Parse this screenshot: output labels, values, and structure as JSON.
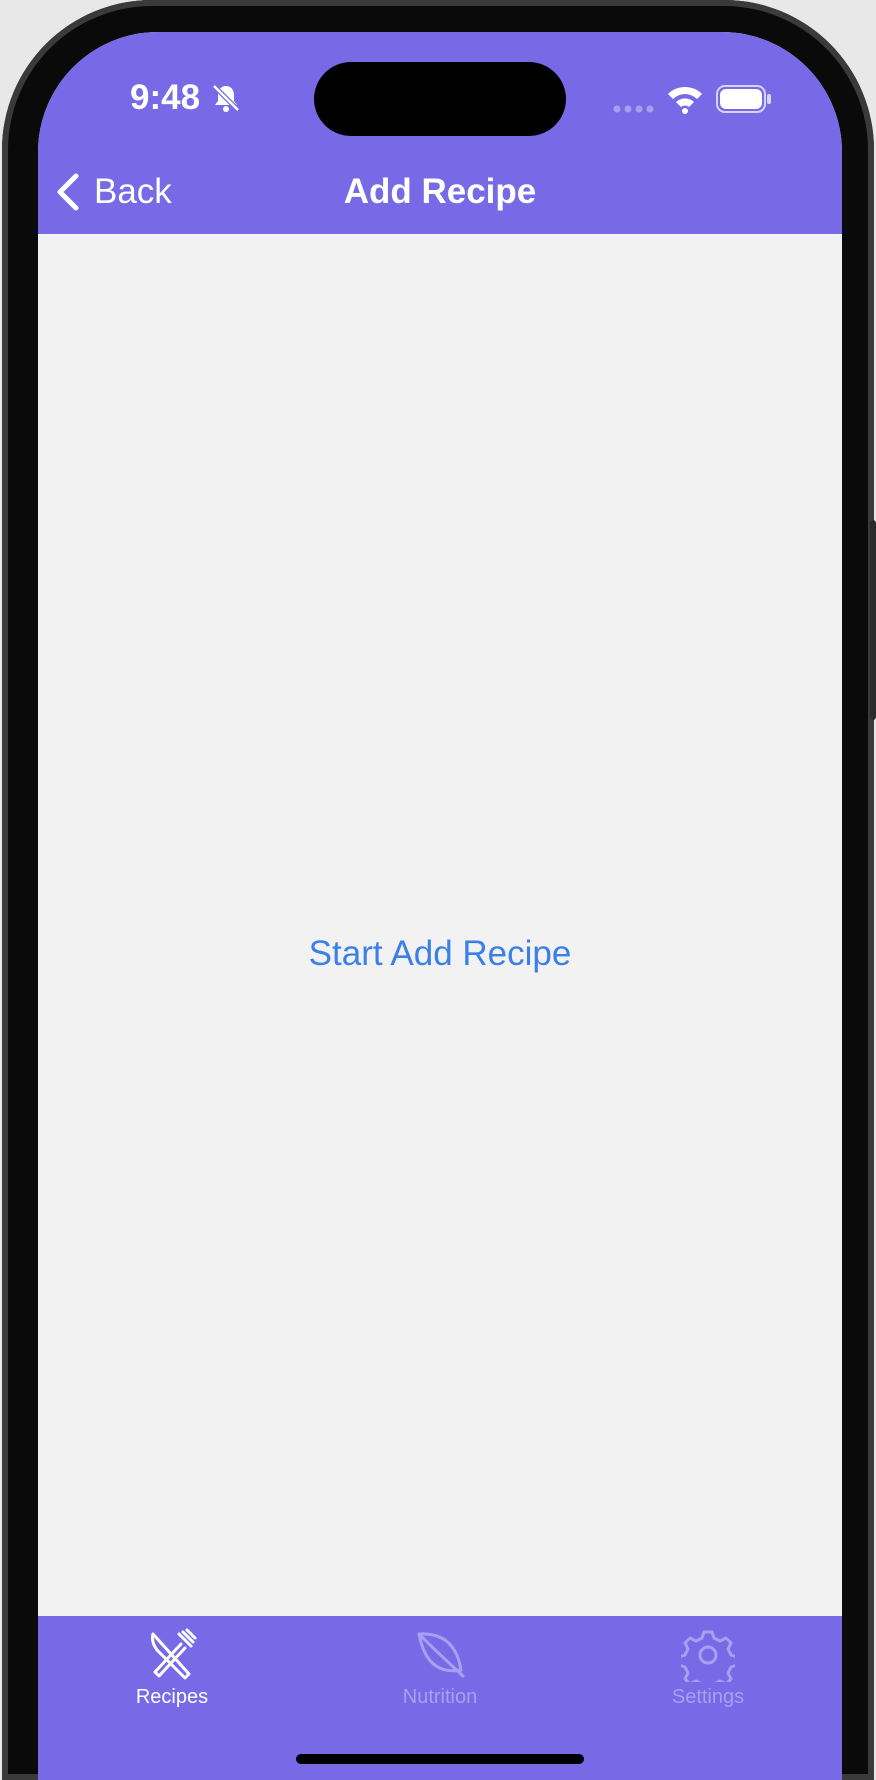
{
  "status_bar": {
    "time": "9:48"
  },
  "nav": {
    "back_label": "Back",
    "title": "Add Recipe"
  },
  "main": {
    "start_button_label": "Start Add Recipe"
  },
  "tab_bar": {
    "tabs": [
      {
        "label": "Recipes",
        "icon": "fork-knife-icon",
        "selected": true
      },
      {
        "label": "Nutrition",
        "icon": "leaf-icon",
        "selected": false
      },
      {
        "label": "Settings",
        "icon": "gear-icon",
        "selected": false
      }
    ]
  },
  "colors": {
    "accent": "#7869e6",
    "link": "#3a80e8",
    "background": "#f2f2f2",
    "tab_inactive": "#a99ff0"
  }
}
